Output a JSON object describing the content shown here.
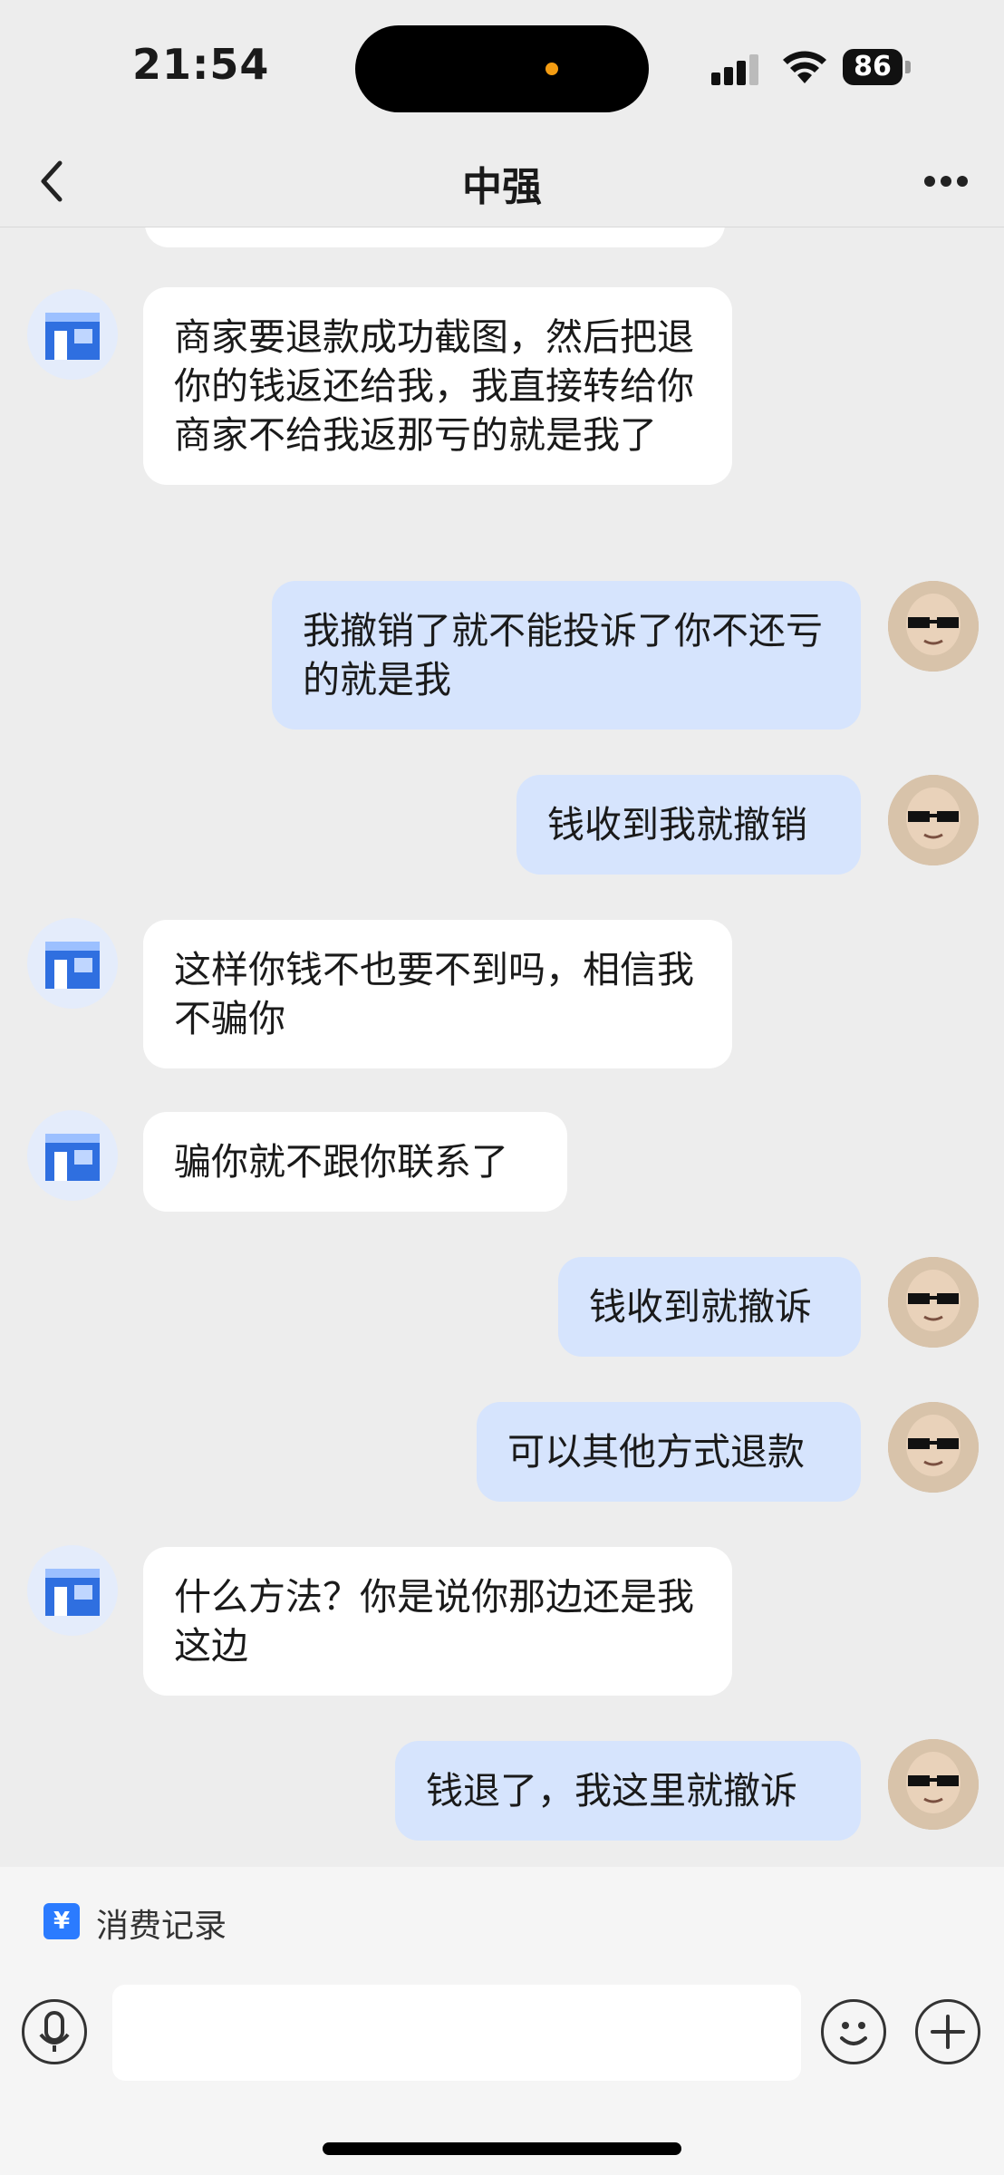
{
  "status_bar": {
    "time": "21:54",
    "battery": "86"
  },
  "nav": {
    "title": "中强"
  },
  "messages": [
    {
      "side": "in",
      "text": "商家要退款成功截图，然后把退你的钱返还给我，我直接转给你商家不给我返那亏的就是我了"
    },
    {
      "side": "out",
      "text": "我撤销了就不能投诉了你不还亏的就是我"
    },
    {
      "side": "out",
      "text": "钱收到我就撤销"
    },
    {
      "side": "in",
      "text": "这样你钱不也要不到吗，相信我不骗你"
    },
    {
      "side": "in",
      "text": "骗你就不跟你联系了"
    },
    {
      "side": "out",
      "text": "钱收到就撤诉"
    },
    {
      "side": "out",
      "text": "可以其他方式退款"
    },
    {
      "side": "in",
      "text": "什么方法？你是说你那边还是我这边"
    },
    {
      "side": "out",
      "text": "钱退了，我这里就撤诉"
    }
  ],
  "quick_actions": [
    {
      "label": "消费记录",
      "icon": "receipt-yen-icon",
      "glyph": "¥"
    }
  ],
  "input": {
    "value": "",
    "placeholder": ""
  },
  "colors": {
    "bubble_in": "#FFFFFF",
    "bubble_out": "#D6E4FD",
    "background": "#EDEDED",
    "accent": "#2B7BFF"
  }
}
